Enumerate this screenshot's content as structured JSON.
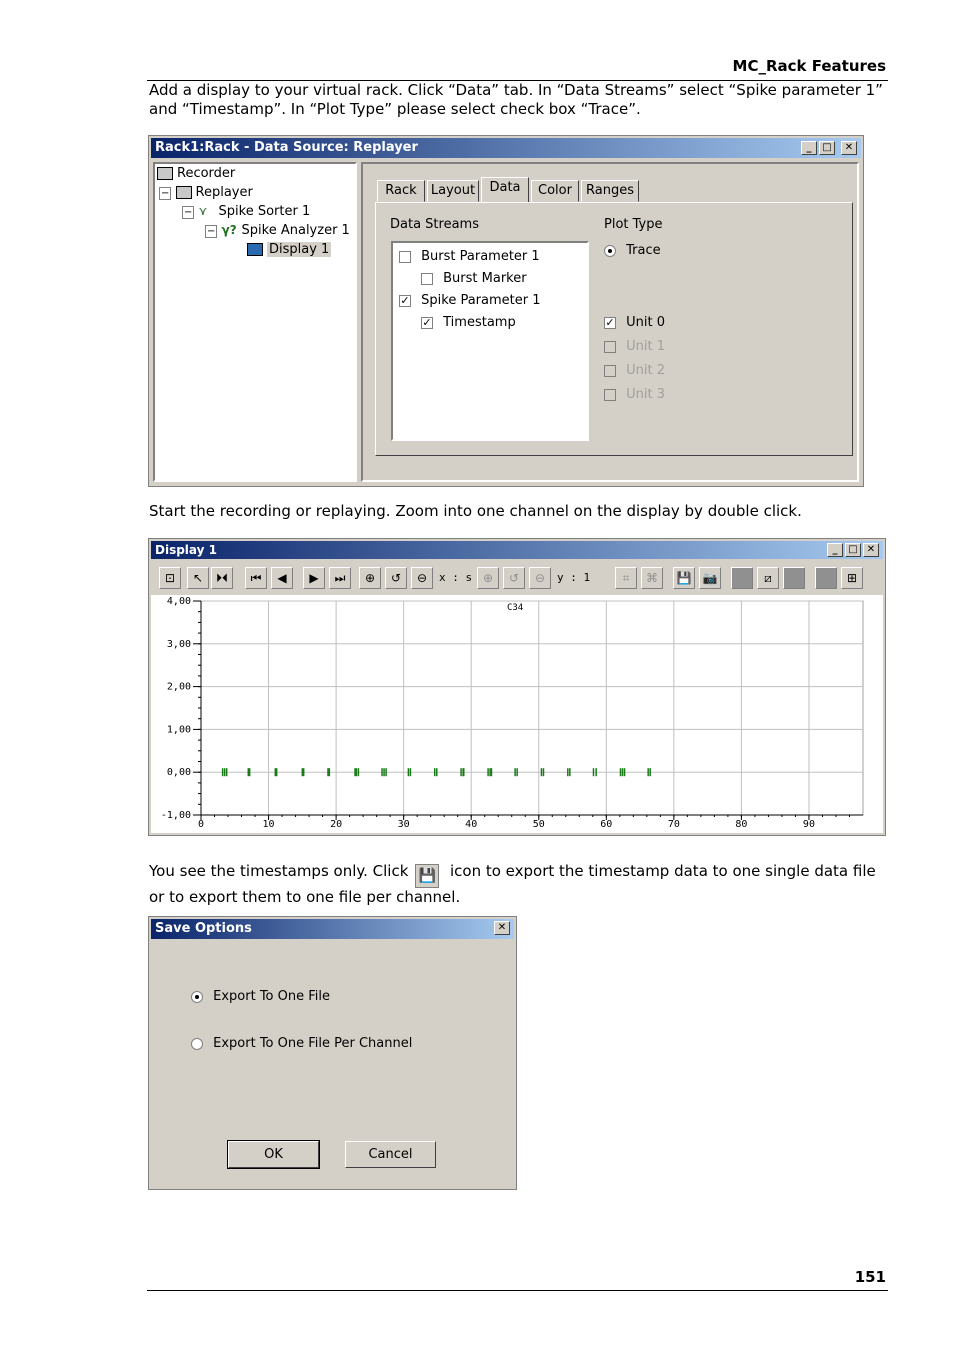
{
  "header": {
    "section": "MC_Rack Features"
  },
  "paragraphs": {
    "p1": "Add a display to your virtual rack. Click “Data” tab. In “Data Streams” select “Spike parameter 1” and “Timestamp”. In “Plot Type” please select check box “Trace”.",
    "p2": "Start the recording or replaying. Zoom into one channel on the display by double click.",
    "p3a": "You see the timestamps only. Click",
    "p3b": "icon to export the timestamp data to one single data file or to export them to one file per channel."
  },
  "rack_window": {
    "title": "Rack1:Rack - Data Source: Replayer",
    "tree": [
      "Recorder",
      "Replayer",
      "Spike Sorter 1",
      "Spike Analyzer 1",
      "Display 1"
    ],
    "tabs": [
      "Rack",
      "Layout",
      "Data",
      "Color",
      "Ranges"
    ],
    "active_tab": "Data",
    "data_streams_label": "Data Streams",
    "streams": [
      {
        "label": "Burst Parameter 1",
        "checked": false
      },
      {
        "label": "Burst Marker",
        "checked": false
      },
      {
        "label": "Spike Parameter 1",
        "checked": true
      },
      {
        "label": "Timestamp",
        "checked": true
      }
    ],
    "plot_type_label": "Plot Type",
    "trace_label": "Trace",
    "units": [
      {
        "label": "Unit 0",
        "checked": true,
        "enabled": true
      },
      {
        "label": "Unit 1",
        "checked": false,
        "enabled": false
      },
      {
        "label": "Unit 2",
        "checked": false,
        "enabled": false
      },
      {
        "label": "Unit 3",
        "checked": false,
        "enabled": false
      }
    ]
  },
  "display_window": {
    "title": "Display 1",
    "x_scale_label": "x : s",
    "y_scale_label": "y : 1",
    "chart_data": {
      "type": "scatter",
      "channel_label": "C34",
      "x_ticks": [
        "0",
        "10",
        "20",
        "30",
        "40",
        "50",
        "60",
        "70",
        "80",
        "90"
      ],
      "y_ticks": [
        "4,00",
        "3,00",
        "2,00",
        "1,00",
        "0,00",
        "-1,00"
      ],
      "xlim": [
        0,
        98
      ],
      "ylim": [
        -1,
        4
      ],
      "grid": true,
      "marker_color": "#1a7a1a",
      "timestamps": [
        3.2,
        3.5,
        3.8,
        7.0,
        7.2,
        11.0,
        11.2,
        15.0,
        15.2,
        18.8,
        19.0,
        22.8,
        23.0,
        23.3,
        26.8,
        27.1,
        27.4,
        30.7,
        31.0,
        34.6,
        34.9,
        38.5,
        38.8,
        38.9,
        42.5,
        42.8,
        43.0,
        46.5,
        46.8,
        50.4,
        50.7,
        54.3,
        54.6,
        58.1,
        58.5,
        62.1,
        62.4,
        62.7,
        66.2,
        66.5
      ],
      "timestamp_y": 0
    }
  },
  "save_dialog": {
    "title": "Save Options",
    "close_glyph": "✕",
    "options": [
      {
        "label": "Export To One File",
        "selected": true
      },
      {
        "label": "Export To One File Per Channel",
        "selected": false
      }
    ],
    "ok_label": "OK",
    "cancel_label": "Cancel"
  },
  "footer": {
    "page_number": "151"
  }
}
